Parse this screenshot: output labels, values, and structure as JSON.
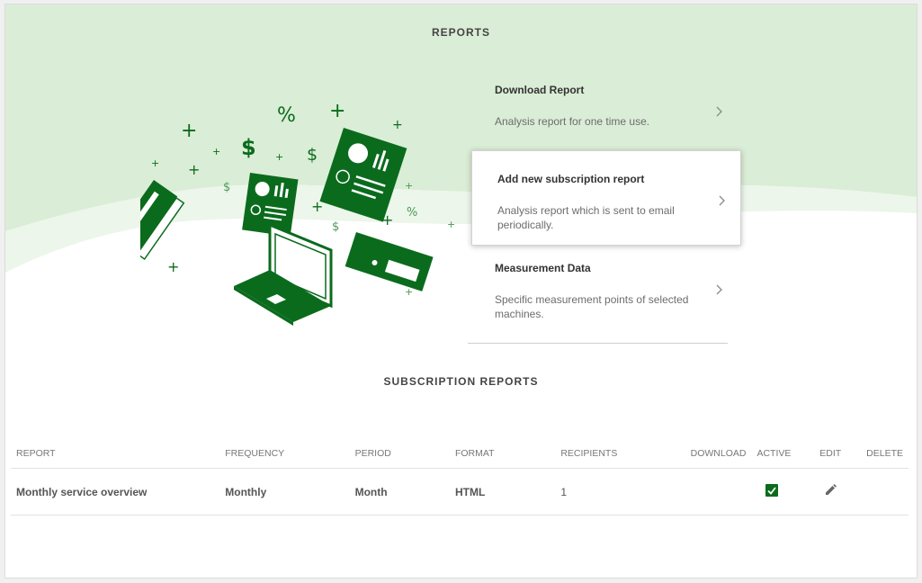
{
  "page": {
    "title": "REPORTS",
    "subscriptions_title": "SUBSCRIPTION REPORTS"
  },
  "colors": {
    "brand_green": "#0b6b1d",
    "hero_light": "#daedd6",
    "hero_wave": "#ecf6ea"
  },
  "illustration": {
    "icon": "reports-illustration",
    "symbols": [
      "+",
      "%",
      "$"
    ]
  },
  "options": [
    {
      "title": "Download Report",
      "description": "Analysis report for one time use.",
      "icon": "chevron-right-icon"
    },
    {
      "title": "Add new subscription report",
      "description": "Analysis report which is sent to email periodically.",
      "icon": "chevron-right-icon"
    },
    {
      "title": "Measurement Data",
      "description": "Specific measurement points of selected machines.",
      "icon": "chevron-right-icon"
    }
  ],
  "table": {
    "headers": {
      "report": "REPORT",
      "frequency": "FREQUENCY",
      "period": "PERIOD",
      "format": "FORMAT",
      "recipients": "RECIPIENTS",
      "download": "DOWNLOAD",
      "active": "ACTIVE",
      "edit": "EDIT",
      "delete": "DELETE"
    },
    "rows": [
      {
        "report": "Monthly service overview",
        "frequency": "Monthly",
        "period": "Month",
        "format": "HTML",
        "recipients": "1",
        "active": true,
        "edit_icon": "pencil-icon"
      }
    ]
  }
}
